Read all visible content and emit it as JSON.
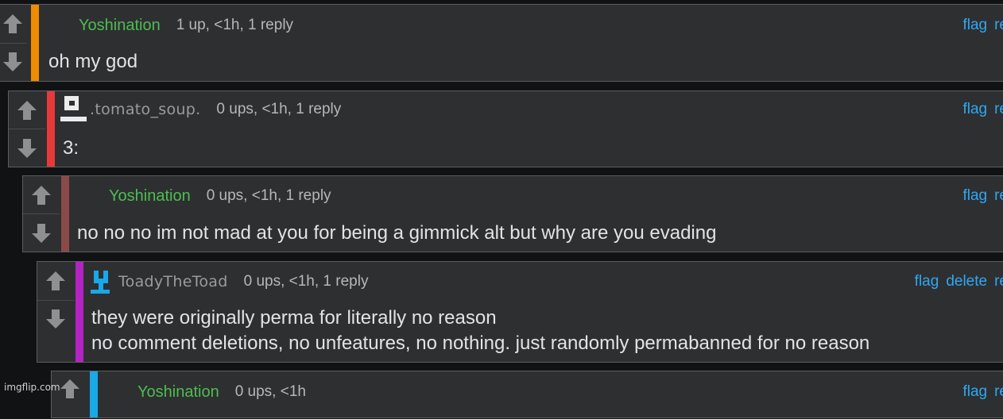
{
  "colors": {
    "background": "#111213",
    "card": "#2e2f31",
    "username_green": "#4dbd50",
    "link_blue": "#2fa8f2",
    "thread_bars": [
      "#f08c00",
      "#e8393a",
      "#8a4a4a",
      "#b324c4",
      "#19a8e8"
    ]
  },
  "icons": {
    "upvote": "arrow-up-icon",
    "downvote": "arrow-down-icon",
    "avatar_tomato": "tomato-soup-avatar-icon",
    "avatar_toady": "toady-avatar-icon"
  },
  "comments": [
    {
      "author": "Yoshination",
      "stats": "1 up, <1h, 1 reply",
      "text": [
        "oh my god"
      ],
      "actions": [
        "flag",
        "re"
      ]
    },
    {
      "author": ".tomato_soup.",
      "stats": "0 ups, <1h, 1 reply",
      "text": [
        "3:"
      ],
      "actions": [
        "flag",
        "re"
      ]
    },
    {
      "author": "Yoshination",
      "stats": "0 ups, <1h, 1 reply",
      "text": [
        "no no no im not mad at you for being a gimmick alt but why are you evading"
      ],
      "actions": [
        "flag",
        "re"
      ]
    },
    {
      "author": "ToadyTheToad",
      "stats": "0 ups, <1h, 1 reply",
      "text": [
        "they were originally perma for literally no reason",
        "no comment deletions, no unfeatures, no nothing. just randomly permabanned for no reason"
      ],
      "actions": [
        "flag",
        "delete",
        "re"
      ]
    },
    {
      "author": "Yoshination",
      "stats": "0 ups, <1h",
      "text": [],
      "actions": [
        "flag",
        "re"
      ]
    }
  ],
  "watermark": "imgflip.com"
}
